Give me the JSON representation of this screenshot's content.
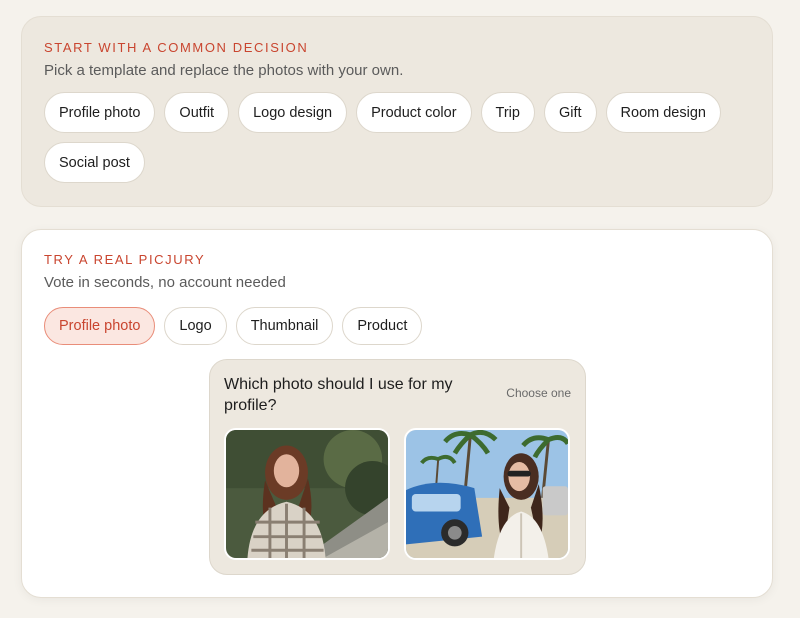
{
  "templates": {
    "eyebrow": "START WITH A COMMON DECISION",
    "subtitle": "Pick a template and replace the photos with your own.",
    "chips": [
      "Profile photo",
      "Outfit",
      "Logo design",
      "Product color",
      "Trip",
      "Gift",
      "Room design",
      "Social post"
    ]
  },
  "demo": {
    "eyebrow": "TRY A REAL PICJURY",
    "subtitle": "Vote in seconds, no account needed",
    "tabs": [
      "Profile photo",
      "Logo",
      "Thumbnail",
      "Product"
    ],
    "active_tab": "Profile photo",
    "poll": {
      "question": "Which photo should I use for my profile?",
      "mode": "Choose one",
      "photos": [
        "photo-a",
        "photo-b"
      ]
    }
  },
  "colors": {
    "accent": "#c9452f",
    "accent_bg": "#fbe7e1",
    "card_bg": "#ede8df",
    "page_bg": "#f5f2ec"
  }
}
